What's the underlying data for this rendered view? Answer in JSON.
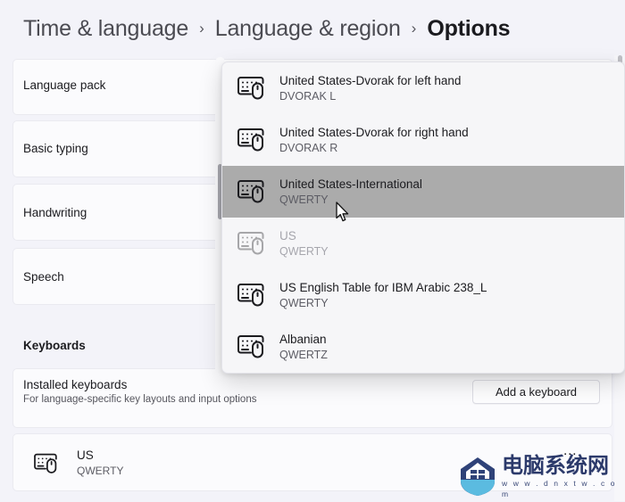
{
  "breadcrumb": {
    "items": [
      {
        "label": "Time & language",
        "current": false
      },
      {
        "label": "Language & region",
        "current": false
      },
      {
        "label": "Options",
        "current": true
      }
    ],
    "separator": "›"
  },
  "settings_cards": [
    {
      "label": "Language pack"
    },
    {
      "label": "Basic typing"
    },
    {
      "label": "Handwriting"
    },
    {
      "label": "Speech"
    }
  ],
  "keyboards_section": {
    "heading": "Keyboards",
    "installed": {
      "title": "Installed keyboards",
      "subtitle": "For language-specific key layouts and input options",
      "add_button": "Add a keyboard"
    },
    "installed_list": [
      {
        "name": "US",
        "layout": "QWERTY",
        "icon": "keyboard-icon",
        "more": "…"
      }
    ]
  },
  "keyboard_flyout": {
    "items": [
      {
        "name": "United States-Dvorak for left hand",
        "layout": "DVORAK L",
        "state": "normal",
        "icon": "keyboard-icon"
      },
      {
        "name": "United States-Dvorak for right hand",
        "layout": "DVORAK R",
        "state": "normal",
        "icon": "keyboard-icon"
      },
      {
        "name": "United States-International",
        "layout": "QWERTY",
        "state": "selected",
        "icon": "keyboard-icon"
      },
      {
        "name": "US",
        "layout": "QWERTY",
        "state": "disabled",
        "icon": "keyboard-icon"
      },
      {
        "name": "US English Table for IBM Arabic 238_L",
        "layout": "QWERTY",
        "state": "normal",
        "icon": "keyboard-icon"
      },
      {
        "name": "Albanian",
        "layout": "QWERTZ",
        "state": "normal",
        "icon": "keyboard-icon"
      }
    ]
  },
  "watermark": {
    "site_name": "电脑系统网",
    "url": "w w w . d n x t w . c o m"
  },
  "colors": {
    "page_background": "#f3f3f9",
    "card_background": "#fbfbfd",
    "flyout_background": "#f6f6f8",
    "selection_highlight": "#ababab",
    "text_primary": "#1b1b1f",
    "text_secondary": "#5c5c64",
    "text_disabled": "#a6a6ad",
    "watermark_blue": "#2c3a6b"
  }
}
